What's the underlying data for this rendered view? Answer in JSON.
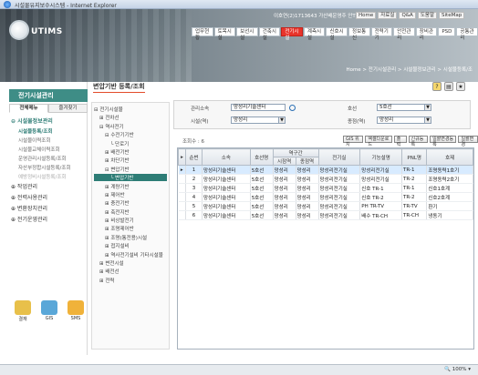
{
  "window": {
    "title": "시설물유지보수시스템 - Internet Explorer"
  },
  "header": {
    "logo_text": "UTIMS",
    "user_info": "이호연(2)1713643 가산배운영주 안TF",
    "util_links": [
      "Home",
      "자료실",
      "Q&A",
      "도움말",
      "SiteMap"
    ],
    "menus": [
      "업무현황",
      "토목시설",
      "보선시설",
      "건축시설",
      "전기시설",
      "계측시설",
      "신호시설",
      "정보통신",
      "전력기기",
      "안전관리",
      "장비관리",
      "PSD",
      "공통관리"
    ],
    "active_menu": "전기시설",
    "location": "Home > 전기시설관리 > 시설물정보관리 > 시설물등록/조"
  },
  "left": {
    "title": "전기시설관리",
    "tabs": [
      "전체메뉴",
      "즐겨찾기"
    ],
    "menu": [
      {
        "label": "시설물정보관리",
        "open": true,
        "subs": [
          {
            "label": "시설물등록/조회",
            "active": true
          },
          {
            "label": "시설물이력조회"
          },
          {
            "label": "시설물교체이력조회"
          },
          {
            "label": "운영관리시설등록/조회"
          },
          {
            "label": "자산부정합시설등록/조회"
          },
          {
            "label": "예방정비시설등록/조회",
            "faded": true
          }
        ]
      },
      {
        "label": "작업관리"
      },
      {
        "label": "전력사용관리"
      },
      {
        "label": "변환장치관리"
      },
      {
        "label": "전기운영관리"
      }
    ],
    "icons": [
      {
        "name": "admin-icon",
        "label": "결재",
        "color": "#e8c04a"
      },
      {
        "name": "gis-icon",
        "label": "GIS",
        "color": "#5aa7d8"
      },
      {
        "name": "sms-icon",
        "label": "SMS",
        "color": "#f0b23a"
      }
    ]
  },
  "content": {
    "title": "변압기반 등록/조회",
    "tree": [
      {
        "label": "⊟ 전기시설물",
        "indent": 0
      },
      {
        "label": "⊞ 전차선",
        "indent": 1
      },
      {
        "label": "⊟ 역사전기",
        "indent": 1
      },
      {
        "label": "⊟ 수전기기반",
        "indent": 2
      },
      {
        "label": "└ 단로기",
        "indent": 3
      },
      {
        "label": "⊞ 배전기반",
        "indent": 2
      },
      {
        "label": "⊞ 차단기반",
        "indent": 2
      },
      {
        "label": "⊟ 변압기반",
        "indent": 2
      },
      {
        "label": "└ 변압기반",
        "indent": 3,
        "selected": true
      },
      {
        "label": "⊞ 계량기반",
        "indent": 2
      },
      {
        "label": "⊞ 제어반",
        "indent": 2
      },
      {
        "label": "⊞ 충전기반",
        "indent": 2
      },
      {
        "label": "⊞ 축전지반",
        "indent": 2
      },
      {
        "label": "⊞ 비상발전기",
        "indent": 2
      },
      {
        "label": "⊞ 조명제어반",
        "indent": 2
      },
      {
        "label": "⊞ 조명(통전용)시설",
        "indent": 2
      },
      {
        "label": "⊞ 접지설비",
        "indent": 2
      },
      {
        "label": "⊞ 역사전기설비 기타시설물",
        "indent": 2
      },
      {
        "label": "⊞ 변전시설",
        "indent": 1
      },
      {
        "label": "⊞ 배전선",
        "indent": 1
      },
      {
        "label": "⊞ 전력",
        "indent": 1
      }
    ],
    "search": {
      "org_label": "관리소속",
      "org_value": "망성리기술센터",
      "line_label": "호선",
      "line_value": "5호선",
      "facility_label": "시설(역)",
      "facility_value": "망성리",
      "type_label": "종점(역)",
      "type_value": "망성리"
    },
    "total": "조회수 : 6",
    "action_buttons": [
      "GIS 위치",
      "엑셀다운로드",
      "출력",
      "신규등록",
      "일괄변경등록",
      "일괄변경"
    ],
    "columns": [
      "순번",
      "소속",
      "호선명",
      "시점역",
      "종점역",
      "역구간",
      "전기실",
      "기능설명",
      "PNL명",
      "호제"
    ],
    "column_group": "역구간",
    "rows": [
      [
        "1",
        "망성리기술센터",
        "5호선",
        "망성리",
        "망성리",
        "망성리전기실",
        "망성리전기실",
        "TR-1",
        "조명동력1호기"
      ],
      [
        "2",
        "망성리기술센터",
        "5호선",
        "망성리",
        "망성리",
        "망성리전기실",
        "망성리전기실",
        "TR-2",
        "조명동력2호기"
      ],
      [
        "3",
        "망성리기술센터",
        "5호선",
        "망성리",
        "망성리",
        "망성리전기실",
        "신호 TR-1",
        "TR-1",
        "신호1호계"
      ],
      [
        "4",
        "망성리기술센터",
        "5호선",
        "망성리",
        "망성리",
        "망성리전기실",
        "신호 TR-2",
        "TR-2",
        "신호2호계"
      ],
      [
        "5",
        "망성리기술센터",
        "5호선",
        "망성리",
        "망성리",
        "망성리전기실",
        "PH TR-TV",
        "TR-TV",
        "환기"
      ],
      [
        "6",
        "망성리기술센터",
        "5호선",
        "망성리",
        "망성리",
        "망성리전기실",
        "배수 TR-CH",
        "TR-CH",
        "냉동기"
      ]
    ],
    "selected_row": 0
  },
  "status": {
    "zoom": "100%"
  },
  "colors": {
    "accent": "#e8342b",
    "left_title": "#3e8d86",
    "selected_row": "#d8ebff"
  }
}
